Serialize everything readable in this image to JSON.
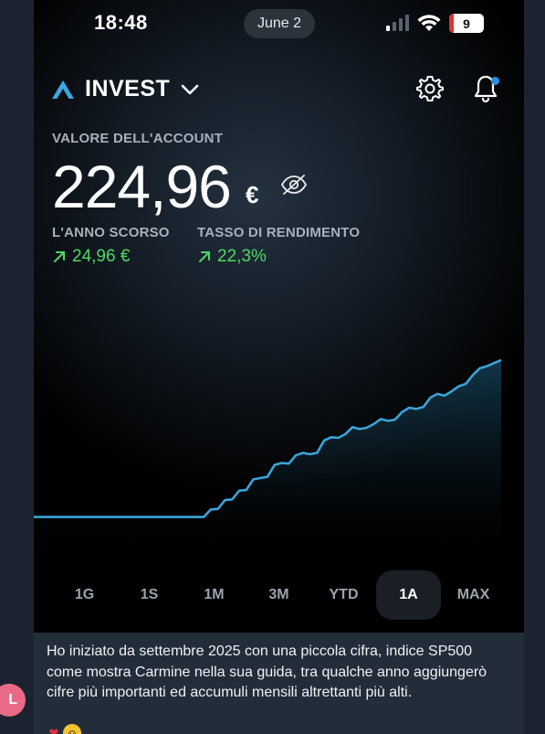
{
  "status_bar": {
    "time": "18:48",
    "date": "June 2",
    "battery": "9"
  },
  "header": {
    "title": "INVEST",
    "brand_icon": "invest-logo-icon",
    "menu_icon": "chevron-down-icon",
    "settings_icon": "gear-icon",
    "notifications_icon": "bell-icon"
  },
  "account": {
    "label": "VALORE DELL'ACCOUNT",
    "value": "224,96",
    "currency": "€",
    "hide_icon": "eye-off-icon"
  },
  "stats": [
    {
      "label": "L'ANNO SCORSO",
      "value": "24,96 €",
      "trend_icon": "arrow-up-right-icon"
    },
    {
      "label": "TASSO DI RENDIMENTO",
      "value": "22,3%",
      "trend_icon": "arrow-up-right-icon"
    }
  ],
  "range_tabs": [
    "1G",
    "1S",
    "1M",
    "3M",
    "YTD",
    "1A",
    "MAX"
  ],
  "active_range": "1A",
  "colors": {
    "accent_blue": "#3aa8e0",
    "positive_green": "#4cd964",
    "chart_line": "#3ba4d8",
    "notification_dot": "#2b8fe0"
  },
  "chart_data": {
    "type": "line",
    "series": [
      {
        "values": [
          200,
          200,
          200,
          200,
          200,
          200,
          200,
          200,
          200,
          200,
          200,
          200,
          200,
          200,
          200,
          200,
          200,
          200,
          200,
          200,
          200,
          200,
          200,
          200,
          200,
          201.2,
          201.3,
          202.7,
          202.8,
          204.2,
          204.3,
          206.0,
          206.2,
          206.4,
          208.3,
          208.6,
          208.5,
          209.8,
          210.2,
          210.0,
          210.2,
          212.2,
          212.7,
          212.6,
          213.2,
          214.3,
          214.0,
          214.2,
          214.8,
          215.6,
          215.3,
          215.5,
          216.7,
          217.4,
          217.2,
          217.5,
          219.0,
          219.6,
          219.3,
          220.0,
          220.8,
          221.2,
          222.6,
          223.7,
          224.0,
          224.5,
          224.96
        ]
      }
    ]
  },
  "message": {
    "avatar_initial": "L",
    "text": "Ho iniziato da settembre 2025 con una piccola cifra, indice SP500 come mostra Carmine nella sua guida, tra qualche anno aggiungerò cifre più importanti ed accumuli mensili altrettanti più alti.",
    "reactions": [
      "heart-reaction-icon",
      "smile-reaction-icon"
    ]
  }
}
